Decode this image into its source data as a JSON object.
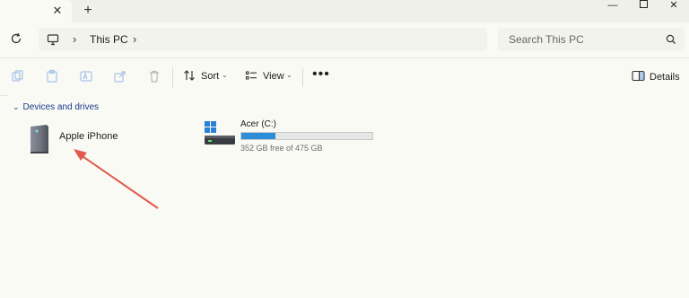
{
  "titlebar": {
    "tab_close": "✕",
    "new_tab": "+",
    "minimize": "—",
    "close": "✕"
  },
  "address": {
    "breadcrumb_sep": "›",
    "location": "This PC",
    "breadcrumb_sep_after": "›",
    "search_placeholder": "Search This PC"
  },
  "toolbar": {
    "sort_label": "Sort",
    "view_label": "View",
    "more_label": "•••",
    "details_label": "Details",
    "chevron": "⌄"
  },
  "content": {
    "group_chevron": "⌄",
    "group_title": "Devices and drives",
    "device": {
      "name": "Apple iPhone",
      "icon": "iphone-icon"
    },
    "drive": {
      "name": "Acer (C:)",
      "free_text": "352 GB free of 475 GB",
      "used_fraction": 0.26,
      "bar_color": "#2a8fd6"
    }
  },
  "annotation": {
    "arrow_color": "#e05a4e"
  }
}
